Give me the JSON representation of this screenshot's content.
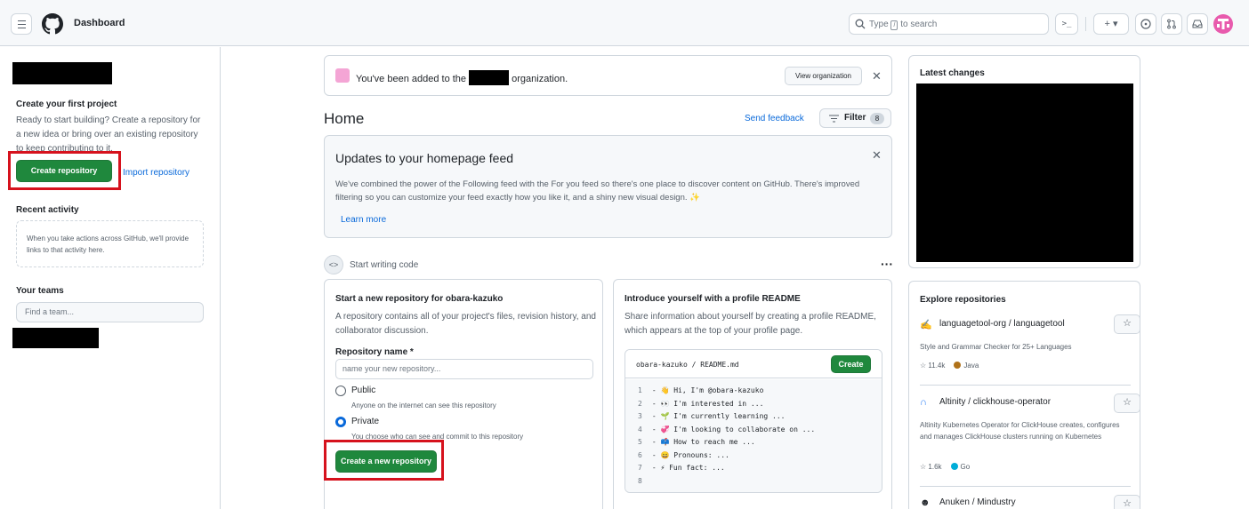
{
  "header": {
    "title": "Dashboard",
    "search_placeholder_pre": "Type",
    "search_key": "/",
    "search_placeholder_post": "to search",
    "cmd_label": ">_",
    "plus_label": "+ ▾",
    "issues_icon": "circle-dot-icon",
    "pr_icon": "git-pull-request-icon",
    "inbox_icon": "inbox-icon"
  },
  "sidebar": {
    "first_project_heading": "Create your first project",
    "first_project_text": "Ready to start building? Create a repository for a new idea or bring over an existing repository to keep contributing to it.",
    "create_repo_label": "Create repository",
    "import_repo_label": "Import repository",
    "recent_heading": "Recent activity",
    "recent_text": "When you take actions across GitHub, we'll provide links to that activity here.",
    "teams_heading": "Your teams",
    "team_placeholder": "Find a team..."
  },
  "main": {
    "org_notice_pre": "You've been added to the",
    "org_notice_post": "organization.",
    "view_org_label": "View organization",
    "home_title": "Home",
    "feedback_label": "Send feedback",
    "filter_label": "Filter",
    "filter_count": "8",
    "updates_title": "Updates to your homepage feed",
    "updates_body": "We've combined the power of the Following feed with the For you feed so there's one place to discover content on GitHub. There's improved filtering so you can customize your feed exactly how you like it, and a shiny new visual design. ✨",
    "learn_more": "Learn more",
    "start_writing": "Start writing code",
    "new_repo_card": {
      "title": "Start a new repository for obara-kazuko",
      "desc": "A repository contains all of your project's files, revision history, and collaborator discussion.",
      "field_label": "Repository name *",
      "field_placeholder": "name your new repository...",
      "public_label": "Public",
      "public_desc": "Anyone on the internet can see this repository",
      "private_label": "Private",
      "private_desc": "You choose who can see and commit to this repository",
      "create_label": "Create a new repository"
    },
    "readme_card": {
      "title": "Introduce yourself with a profile README",
      "desc": "Share information about yourself by creating a profile README, which appears at the top of your profile page.",
      "path": "obara-kazuko / README.md",
      "create_label": "Create",
      "lines": [
        {
          "n": "1",
          "text": "- 👋 Hi, I'm @obara-kazuko"
        },
        {
          "n": "2",
          "text": "- 👀 I'm interested in ..."
        },
        {
          "n": "3",
          "text": "- 🌱 I'm currently learning ..."
        },
        {
          "n": "4",
          "text": "- 💞️ I'm looking to collaborate on ..."
        },
        {
          "n": "5",
          "text": "- 📫 How to reach me ..."
        },
        {
          "n": "6",
          "text": "- 😄 Pronouns: ..."
        },
        {
          "n": "7",
          "text": "- ⚡ Fun fact: ..."
        },
        {
          "n": "8",
          "text": ""
        }
      ]
    }
  },
  "right": {
    "latest_title": "Latest changes",
    "explore_title": "Explore repositories",
    "repos": [
      {
        "owner": "languagetool-org",
        "name": "languagetool",
        "desc": "Style and Grammar Checker for 25+ Languages",
        "stars": "11.4k",
        "lang": "Java",
        "lang_color": "#b07219"
      },
      {
        "owner": "Altinity",
        "name": "clickhouse-operator",
        "desc": "Altinity Kubernetes Operator for ClickHouse creates, configures and manages ClickHouse clusters running on Kubernetes",
        "stars": "1.6k",
        "lang": "Go",
        "lang_color": "#00add8"
      },
      {
        "owner": "Anuken",
        "name": "Mindustry",
        "desc": "",
        "stars": "",
        "lang": "",
        "lang_color": ""
      }
    ]
  },
  "colors": {
    "accent": "#0969da",
    "primary_button": "#1f883d",
    "highlight": "#d6121d"
  }
}
